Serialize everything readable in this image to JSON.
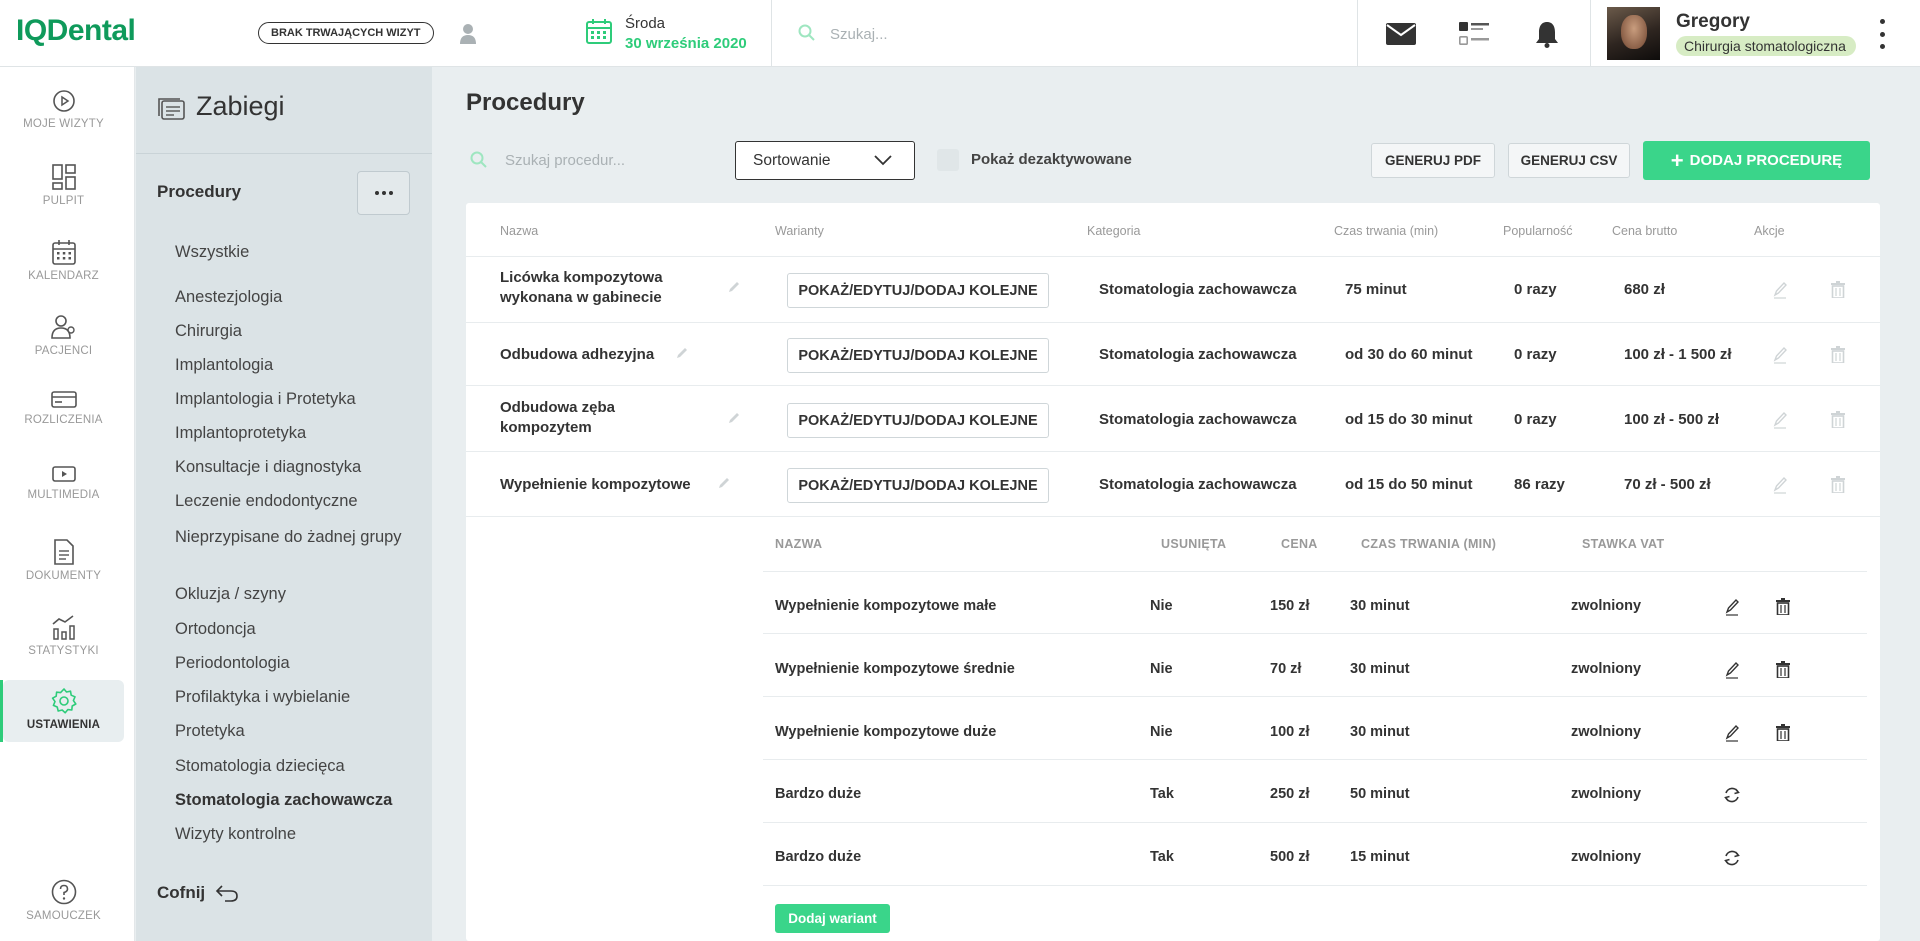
{
  "app": {
    "logo": "IQDental"
  },
  "topbar": {
    "visits_badge": "BRAK TRWAJĄCYCH WIZYT",
    "date_day": "Środa",
    "date_full": "30 września 2020",
    "search_placeholder": "Szukaj...",
    "user_name": "Gregory",
    "user_role": "Chirurgia stomatologiczna"
  },
  "leftnav": {
    "items": [
      {
        "label": "MOJE WIZYTY",
        "icon": "play-circle-icon"
      },
      {
        "label": "PULPIT",
        "icon": "dashboard-icon"
      },
      {
        "label": "KALENDARZ",
        "icon": "calendar-icon"
      },
      {
        "label": "PACJENCI",
        "icon": "patients-icon"
      },
      {
        "label": "ROZLICZENIA",
        "icon": "card-icon"
      },
      {
        "label": "MULTIMEDIA",
        "icon": "media-icon"
      },
      {
        "label": "DOKUMENTY",
        "icon": "document-icon"
      },
      {
        "label": "STATYSTYKI",
        "icon": "stats-icon"
      },
      {
        "label": "USTAWIENIA",
        "icon": "gear-icon"
      }
    ],
    "help": {
      "label": "SAMOUCZEK",
      "icon": "help-icon"
    },
    "accent": "#2ecc7a"
  },
  "subnav": {
    "title": "Zabiegi",
    "section": "Procedury",
    "categories": [
      "Wszystkie",
      "Anestezjologia",
      "Chirurgia",
      "Implantologia",
      "Implantologia i Protetyka",
      "Implantoprotetyka",
      "Konsultacje i diagnostyka",
      "Leczenie endodontyczne",
      "Nieprzypisane do żadnej grupy",
      "Okluzja / szyny",
      "Ortodoncja",
      "Periodontologia",
      "Profilaktyka i wybielanie",
      "Protetyka",
      "Stomatologia dziecięca",
      "Stomatologia zachowawcza",
      "Wizyty kontrolne"
    ],
    "selected": "Stomatologia zachowawcza",
    "back": "Cofnij"
  },
  "main": {
    "title": "Procedury",
    "search_placeholder": "Szukaj procedur...",
    "sort_label": "Sortowanie",
    "show_deactivated": "Pokaż dezaktywowane",
    "btn_pdf": "GENERUJ PDF",
    "btn_csv": "GENERUJ CSV",
    "btn_add": "DODAJ PROCEDURĘ",
    "columns": [
      "Nazwa",
      "Warianty",
      "Kategoria",
      "Czas trwania (min)",
      "Popularność",
      "Cena brutto",
      "Akcje"
    ],
    "variant_button": "POKAŻ/EDYTUJ/DODAJ KOLEJNE",
    "rows": [
      {
        "name": "Licówka kompozytowa wykonana w gabinecie",
        "category": "Stomatologia zachowawcza",
        "duration": "75 minut",
        "popularity": "0 razy",
        "price": "680 zł"
      },
      {
        "name": "Odbudowa adhezyjna",
        "category": "Stomatologia zachowawcza",
        "duration": "od 30 do 60 minut",
        "popularity": "0 razy",
        "price": "100 zł - 1 500 zł"
      },
      {
        "name": "Odbudowa zęba kompozytem",
        "category": "Stomatologia zachowawcza",
        "duration": "od 15 do 30 minut",
        "popularity": "0 razy",
        "price": "100 zł - 500 zł"
      },
      {
        "name": "Wypełnienie kompozytowe",
        "category": "Stomatologia zachowawcza",
        "duration": "od 15 do 50 minut",
        "popularity": "86 razy",
        "price": "70 zł - 500 zł"
      }
    ],
    "variants": {
      "columns": [
        "NAZWA",
        "USUNIĘTA",
        "CENA",
        "CZAS TRWANIA (MIN)",
        "STAWKA VAT"
      ],
      "rows": [
        {
          "name": "Wypełnienie kompozytowe małe",
          "deleted": "Nie",
          "price": "150 zł",
          "duration": "30 minut",
          "vat": "zwolniony"
        },
        {
          "name": "Wypełnienie kompozytowe średnie",
          "deleted": "Nie",
          "price": "70 zł",
          "duration": "30 minut",
          "vat": "zwolniony"
        },
        {
          "name": "Wypełnienie kompozytowe duże",
          "deleted": "Nie",
          "price": "100 zł",
          "duration": "30 minut",
          "vat": "zwolniony"
        },
        {
          "name": "Bardzo duże",
          "deleted": "Tak",
          "price": "250 zł",
          "duration": "50 minut",
          "vat": "zwolniony"
        },
        {
          "name": "Bardzo duże",
          "deleted": "Tak",
          "price": "500 zł",
          "duration": "15 minut",
          "vat": "zwolniony"
        }
      ],
      "add_button": "Dodaj wariant"
    }
  }
}
